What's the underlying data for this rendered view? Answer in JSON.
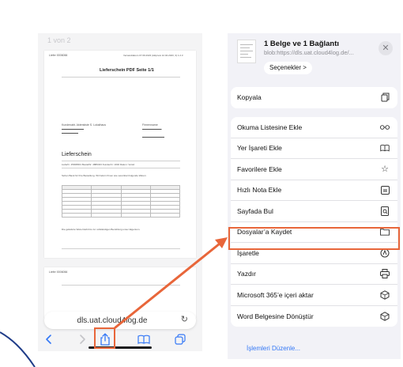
{
  "left_phone": {
    "page_indicator": "1 von 2",
    "document": {
      "title": "Lieferschein  PDF Seite 1/1",
      "heading": "Lieferschein",
      "header_left": "Liefer 0006066",
      "header_right": "Versanddatum 07.09.2023 (Aktpreis 12.04.2023, 3) 1.2.3",
      "address_left": "Kundenabt. Aktenkiste S.  Lokalhaus",
      "address_right": "Firmenname",
      "order_line": "Lieferhr. 25008001   Bestellhr: 4886433   Kundenhr: 1002   Datum: Versd",
      "note_line": "Sehen Bank für Ihre Bestellung. Wir liefern Ihnen wie vereinbart folgende Waren:",
      "footer_line": "Die gelieferte Ware bleibt bis zur vollständigen Bezahlung unser Eigentum."
    },
    "address_bar": {
      "url": "dls.uat.cloud4log.de",
      "reload_icon": "reload-icon"
    },
    "toolbar": {
      "back_icon": "chevron-left-icon",
      "forward_icon": "chevron-right-icon",
      "share_icon": "share-icon",
      "bookmarks_icon": "book-icon",
      "tabs_icon": "tabs-icon"
    }
  },
  "share_sheet": {
    "title": "1 Belge ve 1 Bağlantı",
    "subtitle": "blob:https://dls.uat.cloud4log.de/...",
    "options_label": "Seçenekler >",
    "close_icon": "close-icon",
    "groups": [
      [
        {
          "label": "Kopyala",
          "icon": "copy-icon"
        }
      ],
      [
        {
          "label": "Okuma Listesine Ekle",
          "icon": "glasses-icon"
        },
        {
          "label": "Yer İşareti Ekle",
          "icon": "book-icon"
        },
        {
          "label": "Favorilere Ekle",
          "icon": "star-icon"
        },
        {
          "label": "Hızlı Nota Ekle",
          "icon": "quick-note-icon"
        },
        {
          "label": "Sayfada Bul",
          "icon": "find-in-page-icon"
        },
        {
          "label": "Dosyalar’a Kaydet",
          "icon": "folder-icon"
        },
        {
          "label": "İşaretle",
          "icon": "markup-icon"
        },
        {
          "label": "Yazdır",
          "icon": "printer-icon"
        },
        {
          "label": "Microsoft 365’e içeri aktar",
          "icon": "office-icon"
        },
        {
          "label": "Word Belgesine Dönüştür",
          "icon": "office-icon"
        }
      ]
    ],
    "edit_actions_label": "İşlemleri Düzenle..."
  },
  "annotation": {
    "highlight_color": "#e8663a",
    "arrow_color": "#e8663a"
  }
}
